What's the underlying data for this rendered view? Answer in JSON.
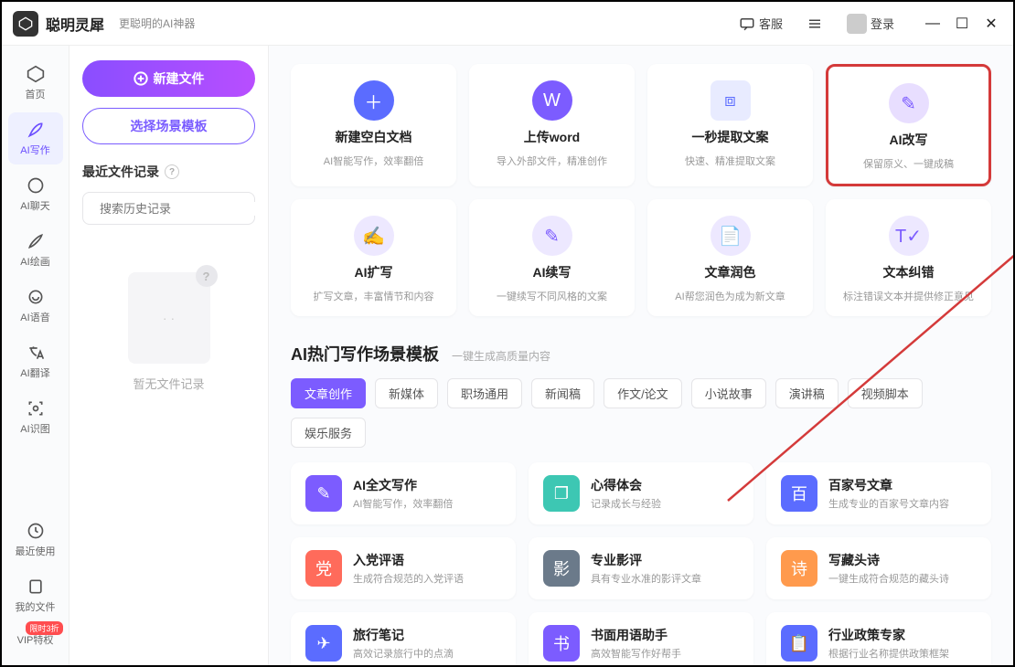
{
  "app": {
    "name": "聪明灵犀",
    "subtitle": "更聪明的AI神器"
  },
  "titlebar": {
    "support": "客服",
    "login": "登录"
  },
  "sidebar": {
    "items": [
      {
        "label": "首页"
      },
      {
        "label": "AI写作"
      },
      {
        "label": "AI聊天"
      },
      {
        "label": "AI绘画"
      },
      {
        "label": "AI语音"
      },
      {
        "label": "AI翻译"
      },
      {
        "label": "AI识图"
      },
      {
        "label": "最近使用"
      },
      {
        "label": "我的文件"
      },
      {
        "label": "VIP特权"
      }
    ],
    "vip_badge": "限时3折"
  },
  "leftpanel": {
    "new_file": "新建文件",
    "choose_template": "选择场景模板",
    "recent_title": "最近文件记录",
    "search_placeholder": "搜索历史记录",
    "empty_text": "暂无文件记录"
  },
  "cards": [
    {
      "title": "新建空白文档",
      "desc": "AI智能写作，效率翻倍"
    },
    {
      "title": "上传word",
      "desc": "导入外部文件，精准创作"
    },
    {
      "title": "一秒提取文案",
      "desc": "快速、精准提取文案"
    },
    {
      "title": "AI改写",
      "desc": "保留原义、一键成稿"
    },
    {
      "title": "AI扩写",
      "desc": "扩写文章，丰富情节和内容"
    },
    {
      "title": "AI续写",
      "desc": "一键续写不同风格的文案"
    },
    {
      "title": "文章润色",
      "desc": "AI帮您润色为成为新文章"
    },
    {
      "title": "文本纠错",
      "desc": "标注错误文本并提供修正意见"
    }
  ],
  "templates": {
    "heading": "AI热门写作场景模板",
    "heading_sub": "一键生成高质量内容",
    "tabs": [
      "文章创作",
      "新媒体",
      "职场通用",
      "新闻稿",
      "作文/论文",
      "小说故事",
      "演讲稿",
      "视频脚本",
      "娱乐服务"
    ],
    "items": [
      {
        "title": "AI全文写作",
        "desc": "AI智能写作，效率翻倍"
      },
      {
        "title": "心得体会",
        "desc": "记录成长与经验"
      },
      {
        "title": "百家号文章",
        "desc": "生成专业的百家号文章内容"
      },
      {
        "title": "入党评语",
        "desc": "生成符合规范的入党评语"
      },
      {
        "title": "专业影评",
        "desc": "具有专业水准的影评文章"
      },
      {
        "title": "写藏头诗",
        "desc": "一键生成符合规范的藏头诗"
      },
      {
        "title": "旅行笔记",
        "desc": "高效记录旅行中的点滴"
      },
      {
        "title": "书面用语助手",
        "desc": "高效智能写作好帮手"
      },
      {
        "title": "行业政策专家",
        "desc": "根据行业名称提供政策框架"
      }
    ]
  }
}
